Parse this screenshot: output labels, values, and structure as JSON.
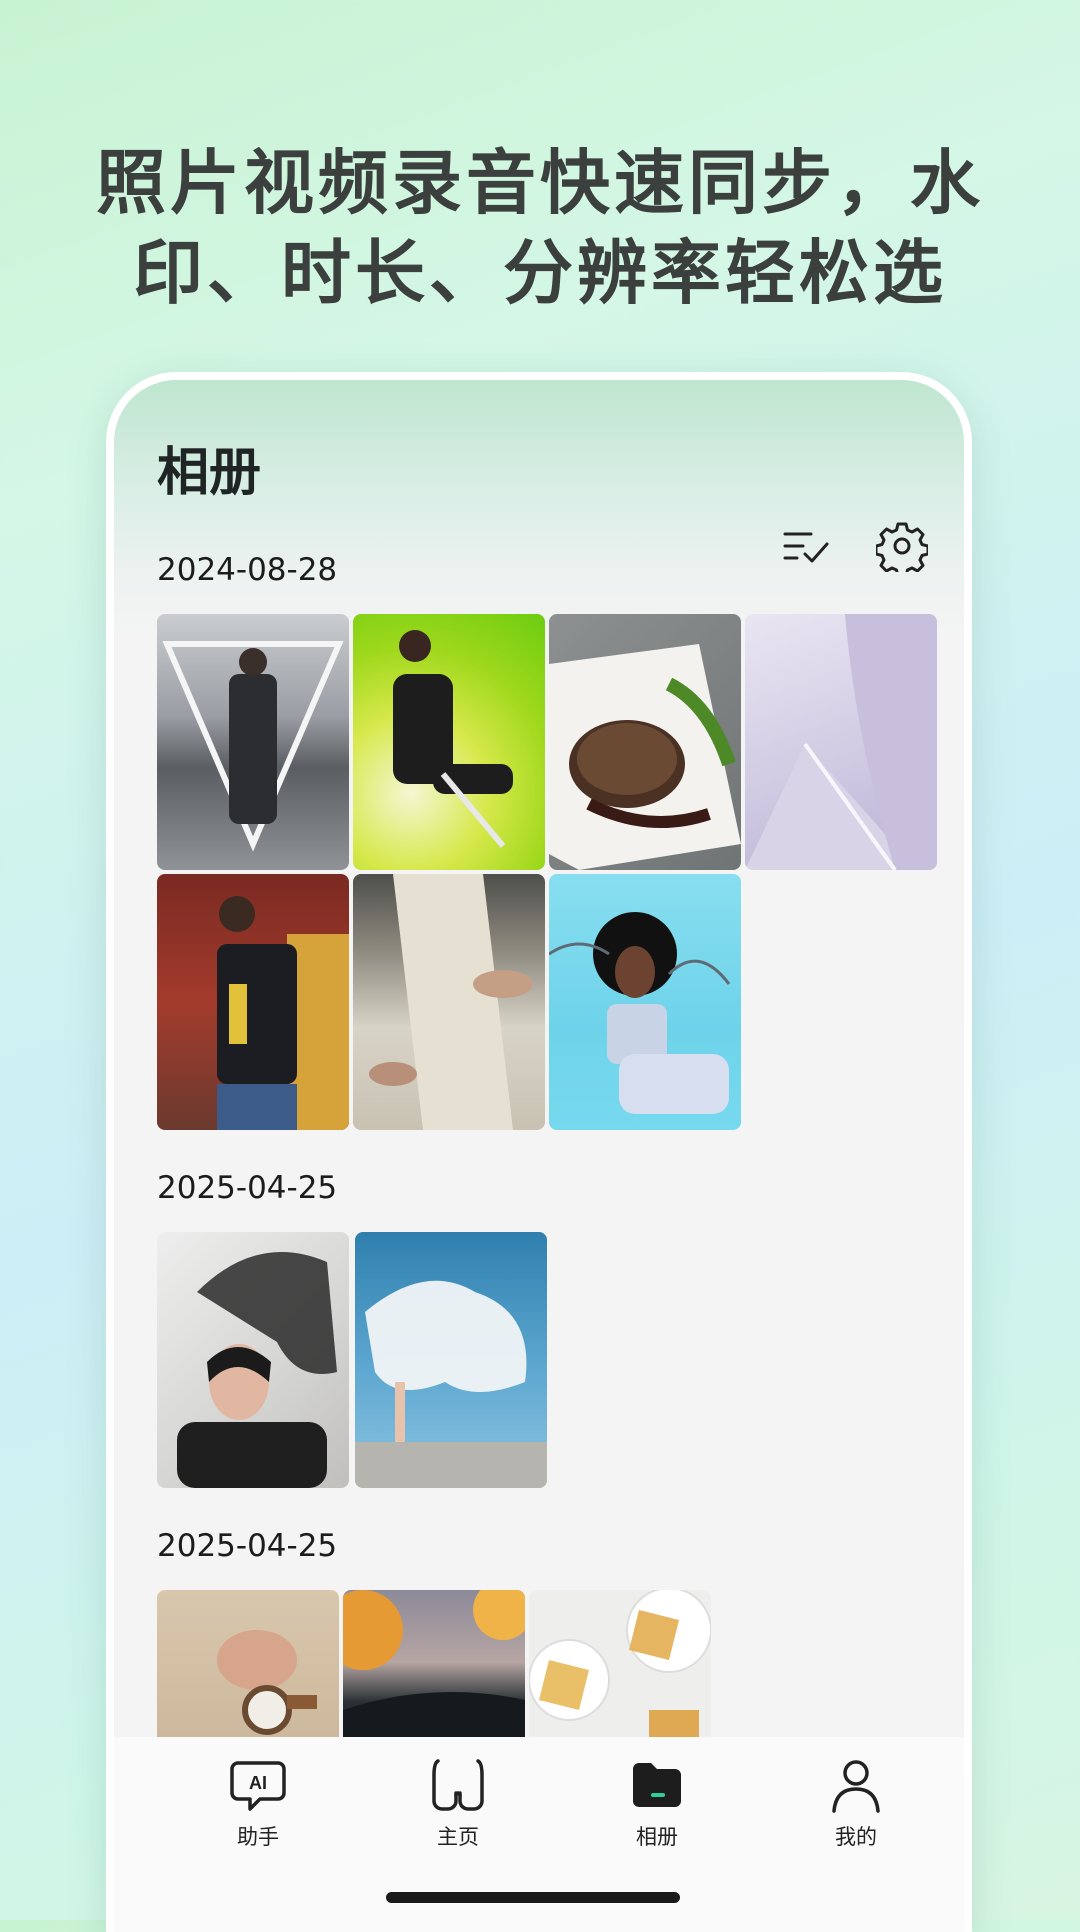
{
  "headline": {
    "line1": "照片视频录音快速同步，水",
    "line2": "印、时长、分辨率轻松选"
  },
  "album": {
    "title": "相册",
    "toolbar": {
      "select_icon": "checklist-icon",
      "settings_icon": "gear-icon"
    },
    "sections": [
      {
        "date": "2024-08-28",
        "photo_count": 7
      },
      {
        "date": "2025-04-25",
        "photo_count": 2
      },
      {
        "date": "2025-04-25",
        "photo_count": 3
      }
    ]
  },
  "tabbar": {
    "items": [
      {
        "label": "助手",
        "icon": "ai-chat-icon",
        "active": false
      },
      {
        "label": "主页",
        "icon": "glasses-icon",
        "active": false
      },
      {
        "label": "相册",
        "icon": "folder-icon",
        "active": true
      },
      {
        "label": "我的",
        "icon": "person-icon",
        "active": false
      }
    ]
  },
  "colors": {
    "accent": "#2fcf9a",
    "text": "#1f2524",
    "headline": "#3b3f3d"
  }
}
